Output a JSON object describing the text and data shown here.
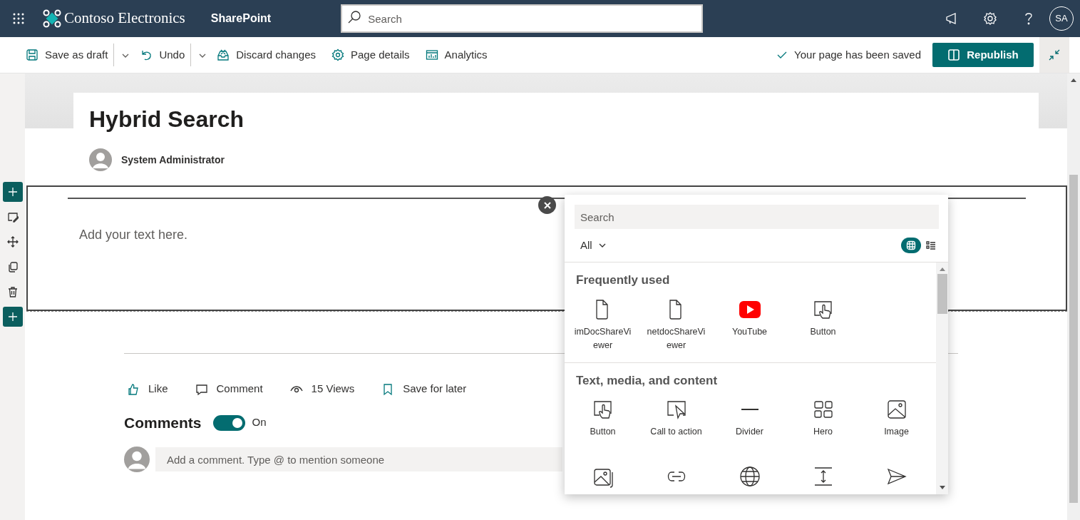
{
  "topbar": {
    "brand": "Contoso Electronics",
    "site": "SharePoint",
    "search": {
      "placeholder": "Search"
    },
    "avatar": "SA"
  },
  "commands": [
    {
      "label": "Save as draft",
      "dropdown": true
    },
    {
      "label": "Undo",
      "dropdown": true
    },
    {
      "label": "Discard changes",
      "dropdown": false
    },
    {
      "label": "Page details",
      "dropdown": false
    },
    {
      "label": "Analytics",
      "dropdown": false
    }
  ],
  "save_status": "Your page has been saved",
  "primary_button": "Republish",
  "page": {
    "title": "Hybrid Search",
    "author": "System Administrator"
  },
  "section": {
    "placeholder": "Add your text here."
  },
  "picker": {
    "search": {
      "placeholder": "Search"
    },
    "filter": "All",
    "views": [
      {
        "selected": true
      },
      {
        "selected": false
      }
    ],
    "groups": [
      {
        "title": "Frequently used",
        "items": [
          {
            "kind": "tile",
            "label": "imDocShareViewer"
          },
          {
            "kind": "tile",
            "label": "netdocShareViewer"
          },
          {
            "kind": "tile",
            "label": "YouTube"
          },
          {
            "kind": "tile",
            "label": "Button"
          }
        ]
      },
      {
        "title": "Text, media, and content",
        "items": [
          {
            "kind": "tile",
            "label": "Button"
          },
          {
            "kind": "tile",
            "label": "Call to action"
          },
          {
            "kind": "tile",
            "label": "Divider"
          },
          {
            "kind": "tile",
            "label": "Hero"
          },
          {
            "kind": "tile",
            "label": "Image"
          },
          {
            "kind": "icon_only"
          },
          {
            "kind": "icon_only"
          },
          {
            "kind": "icon_only"
          },
          {
            "kind": "icon_only"
          },
          {
            "kind": "icon_only"
          }
        ]
      }
    ]
  },
  "social": [
    {
      "label": "Like"
    },
    {
      "label": "Comment"
    },
    {
      "label": "15 Views"
    },
    {
      "label": "Save for later"
    }
  ],
  "comments": {
    "title": "Comments",
    "on": true,
    "state_label": "On",
    "placeholder": "Add a comment. Type @ to mention someone"
  }
}
